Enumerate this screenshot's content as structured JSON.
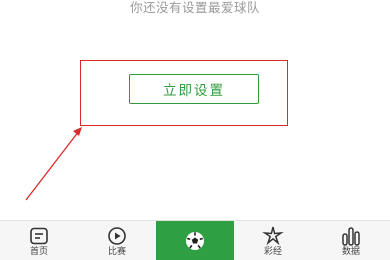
{
  "empty_state": {
    "prompt": "你还没有设置最爱球队",
    "setup_button_label": "立即设置"
  },
  "tabbar": {
    "tabs": [
      {
        "label": "首页",
        "icon": "home-icon"
      },
      {
        "label": "比赛",
        "icon": "play-icon"
      },
      {
        "label": "",
        "icon": "soccer-ball-icon",
        "active": true
      },
      {
        "label": "彩经",
        "icon": "sparkle-icon"
      },
      {
        "label": "数据",
        "icon": "bar-chart-icon"
      }
    ]
  },
  "colors": {
    "accent_green": "#2ea043",
    "button_green": "#2f9a3d",
    "annotation_red": "#d92a2a",
    "prompt_gray": "#9a9a9a",
    "tabbar_bg": "#f6f6f6"
  }
}
